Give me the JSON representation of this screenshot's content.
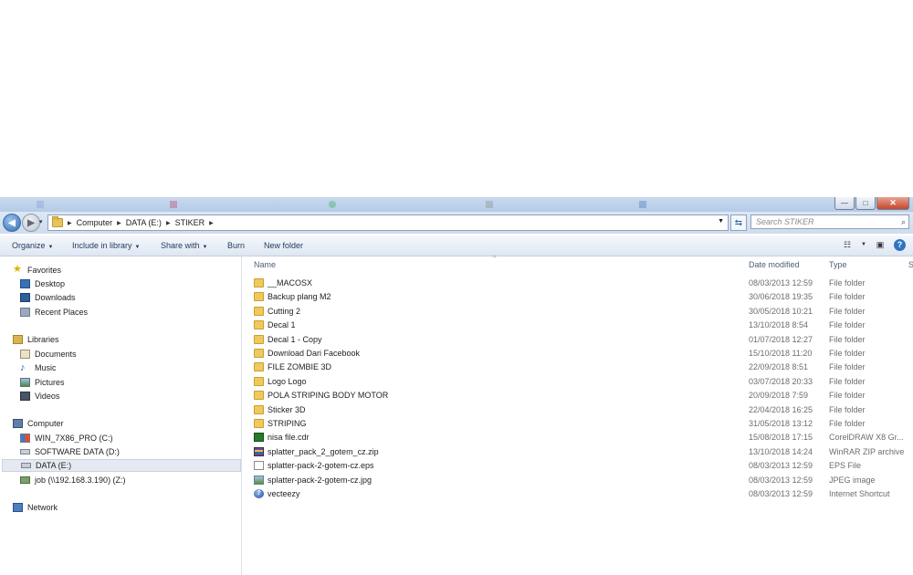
{
  "window": {
    "controls": {
      "minimize": "—",
      "maximize": "□",
      "close": "✕"
    }
  },
  "nav": {
    "back": "◀",
    "forward": "▶",
    "history": "▾"
  },
  "address": {
    "crumbs": [
      "Computer",
      "DATA (E:)",
      "STIKER"
    ],
    "separator": "▶",
    "dropdown": "▼",
    "refresh": "⇆"
  },
  "search": {
    "placeholder": "Search STIKER",
    "icon": "⌕"
  },
  "toolbar": {
    "organize": "Organize",
    "include_in_library": "Include in library",
    "share_with": "Share with",
    "burn": "Burn",
    "new_folder": "New folder",
    "dropdown": "▼",
    "views": "☷",
    "preview": "▣",
    "help": "?"
  },
  "sidebar": {
    "favorites": {
      "label": "Favorites",
      "items": [
        "Desktop",
        "Downloads",
        "Recent Places"
      ]
    },
    "libraries": {
      "label": "Libraries",
      "items": [
        "Documents",
        "Music",
        "Pictures",
        "Videos"
      ]
    },
    "computer": {
      "label": "Computer",
      "items": [
        "WIN_7X86_PRO (C:)",
        "SOFTWARE DATA  (D:)",
        "DATA  (E:)",
        "job (\\\\192.168.3.190) (Z:)"
      ]
    },
    "network": {
      "label": "Network"
    }
  },
  "columns": {
    "name": "Name",
    "date_modified": "Date modified",
    "type": "Type",
    "size": "S",
    "sort": "^"
  },
  "files": [
    {
      "name": "__MACOSX",
      "date": "08/03/2013 12:59",
      "type": "File folder",
      "icon": "folder"
    },
    {
      "name": "Backup plang M2",
      "date": "30/06/2018 19:35",
      "type": "File folder",
      "icon": "folder"
    },
    {
      "name": "Cutting 2",
      "date": "30/05/2018 10:21",
      "type": "File folder",
      "icon": "folder"
    },
    {
      "name": "Decal 1",
      "date": "13/10/2018 8:54",
      "type": "File folder",
      "icon": "folder"
    },
    {
      "name": "Decal 1 - Copy",
      "date": "01/07/2018 12:27",
      "type": "File folder",
      "icon": "folder"
    },
    {
      "name": "Download Dari Facebook",
      "date": "15/10/2018 11:20",
      "type": "File folder",
      "icon": "folder"
    },
    {
      "name": "FILE ZOMBIE 3D",
      "date": "22/09/2018 8:51",
      "type": "File folder",
      "icon": "folder"
    },
    {
      "name": "Logo Logo",
      "date": "03/07/2018 20:33",
      "type": "File folder",
      "icon": "folder"
    },
    {
      "name": "POLA STRIPING BODY MOTOR",
      "date": "20/09/2018 7:59",
      "type": "File folder",
      "icon": "folder"
    },
    {
      "name": "Sticker 3D",
      "date": "22/04/2018 16:25",
      "type": "File folder",
      "icon": "folder"
    },
    {
      "name": "STRIPING",
      "date": "31/05/2018 13:12",
      "type": "File folder",
      "icon": "folder"
    },
    {
      "name": "nisa file.cdr",
      "date": "15/08/2018 17:15",
      "type": "CorelDRAW X8 Gr...",
      "icon": "cdr"
    },
    {
      "name": "splatter_pack_2_gotem_cz.zip",
      "date": "13/10/2018 14:24",
      "type": "WinRAR ZIP archive",
      "icon": "zip"
    },
    {
      "name": "splatter-pack-2-gotem-cz.eps",
      "date": "08/03/2013 12:59",
      "type": "EPS File",
      "icon": "eps"
    },
    {
      "name": "splatter-pack-2-gotem-cz.jpg",
      "date": "08/03/2013 12:59",
      "type": "JPEG image",
      "icon": "jpg"
    },
    {
      "name": "vecteezy",
      "date": "08/03/2013 12:59",
      "type": "Internet Shortcut",
      "icon": "url"
    }
  ]
}
